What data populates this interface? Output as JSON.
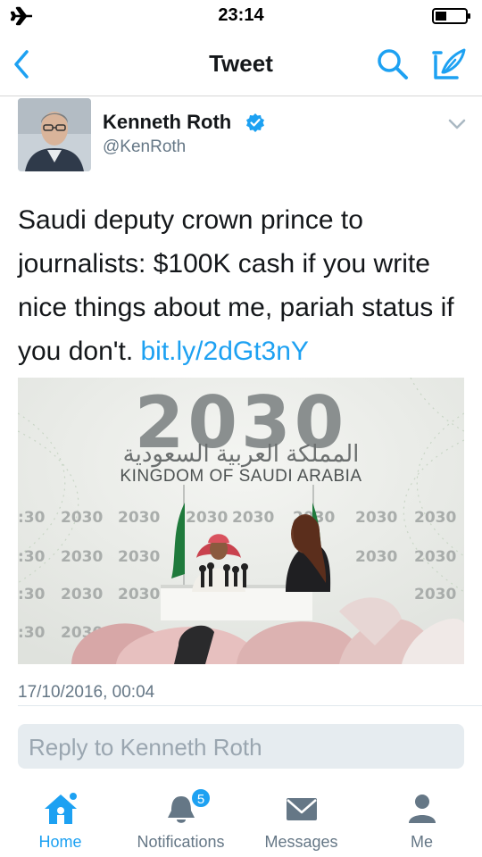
{
  "status_bar": {
    "time": "23:14"
  },
  "nav": {
    "title": "Tweet"
  },
  "author": {
    "name": "Kenneth Roth",
    "handle": "@KenRoth"
  },
  "tweet": {
    "text": "Saudi deputy crown prince to journalists: $100K cash if you write nice things about me, pariah status if you don't.",
    "link": "bit.ly/2dGt3nY",
    "timestamp": "17/10/2016, 00:04"
  },
  "media": {
    "logo_text": "2030",
    "arabic_text": "المملكة العربية السعودية",
    "kingdom_text": "KINGDOM OF SAUDI ARABIA"
  },
  "reply": {
    "placeholder": "Reply to Kenneth Roth"
  },
  "tabs": [
    {
      "label": "Home",
      "icon": "home-icon",
      "active": true
    },
    {
      "label": "Notifications",
      "icon": "bell-icon",
      "badge": "5"
    },
    {
      "label": "Messages",
      "icon": "envelope-icon"
    },
    {
      "label": "Me",
      "icon": "person-icon"
    }
  ],
  "colors": {
    "accent": "#1da1f2",
    "text": "#14171a",
    "secondary": "#657786"
  }
}
